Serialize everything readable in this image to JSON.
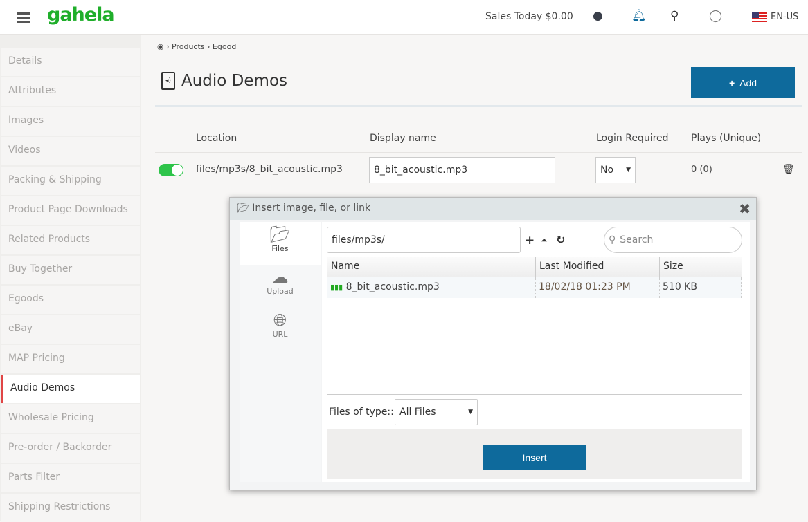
{
  "header": {
    "logo": "gahela",
    "sales": "Sales Today $0.00",
    "lang": "EN-US",
    "icons": [
      "user-icon",
      "bell-icon",
      "search-icon",
      "lifebuoy-icon"
    ],
    "accent": "#0e6a9c"
  },
  "sidebar": {
    "items": [
      {
        "label": "Details"
      },
      {
        "label": "Attributes"
      },
      {
        "label": "Images"
      },
      {
        "label": "Videos"
      },
      {
        "label": "Packing & Shipping"
      },
      {
        "label": "Product Page Downloads"
      },
      {
        "label": "Related Products"
      },
      {
        "label": "Buy Together"
      },
      {
        "label": "Egoods"
      },
      {
        "label": "eBay"
      },
      {
        "label": "MAP Pricing"
      },
      {
        "label": "Audio Demos",
        "active": true
      },
      {
        "label": "Wholesale Pricing"
      },
      {
        "label": "Pre-order / Backorder"
      },
      {
        "label": "Parts Filter"
      },
      {
        "label": "Shipping Restrictions"
      }
    ]
  },
  "breadcrumb": [
    "Products",
    "Egood"
  ],
  "page": {
    "title": "Audio Demos",
    "add_label": "Add"
  },
  "table": {
    "headers": [
      "Location",
      "Display name",
      "Login Required",
      "Plays (Unique)"
    ],
    "rows": [
      {
        "enabled": true,
        "location": "files/mp3s/8_bit_acoustic.mp3",
        "display_name": "8_bit_acoustic.mp3",
        "login_required": "No",
        "plays": "0 (0)"
      }
    ]
  },
  "dialog": {
    "title": "Insert image, file, or link",
    "tabs": [
      "Files",
      "Upload",
      "URL"
    ],
    "path": "files/mp3s/",
    "search_placeholder": "Search",
    "columns": [
      "Name",
      "Last Modified",
      "Size"
    ],
    "files": [
      {
        "name": "8_bit_acoustic.mp3",
        "modified": "18/02/18 01:23 PM",
        "size": "510 KB"
      }
    ],
    "filter_label": "Files of type::",
    "filter_value": "All Files",
    "insert_label": "Insert"
  }
}
